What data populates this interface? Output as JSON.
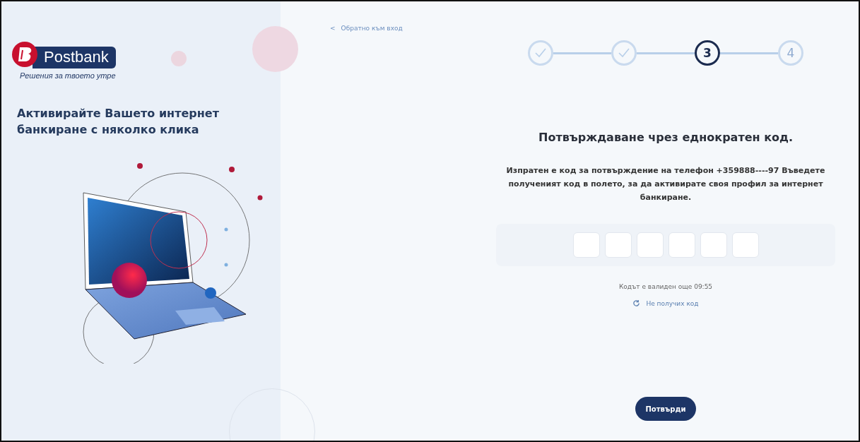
{
  "brand": {
    "name": "Postbank",
    "tagline": "Решения за твоето утре"
  },
  "promo": {
    "headline": "Активирайте Вашето интернет банкиране с няколко клика"
  },
  "back_link": {
    "icon": "<",
    "label": "Обратно към вход"
  },
  "steps": [
    {
      "done": true,
      "selected": false
    },
    {
      "done": true,
      "selected": false
    },
    {
      "done": false,
      "selected": true,
      "label": "3"
    },
    {
      "done": false,
      "selected": false,
      "label": "4"
    }
  ],
  "title": "Потвърждаване чрез еднократен код.",
  "message": "Изпратен е код за потвърждение на телефон +359888----97 Въведете полученият код в полето, за да активирате своя профил за интернет банкиране.",
  "code_fields": [
    {
      "filled": false
    },
    {
      "filled": false
    },
    {
      "filled": false
    },
    {
      "filled": false
    },
    {
      "filled": false
    },
    {
      "filled": false
    }
  ],
  "timer": "Кодът е валиден още 09:55",
  "resend_link": "Не получих код",
  "confirm_button": "Потвърди"
}
